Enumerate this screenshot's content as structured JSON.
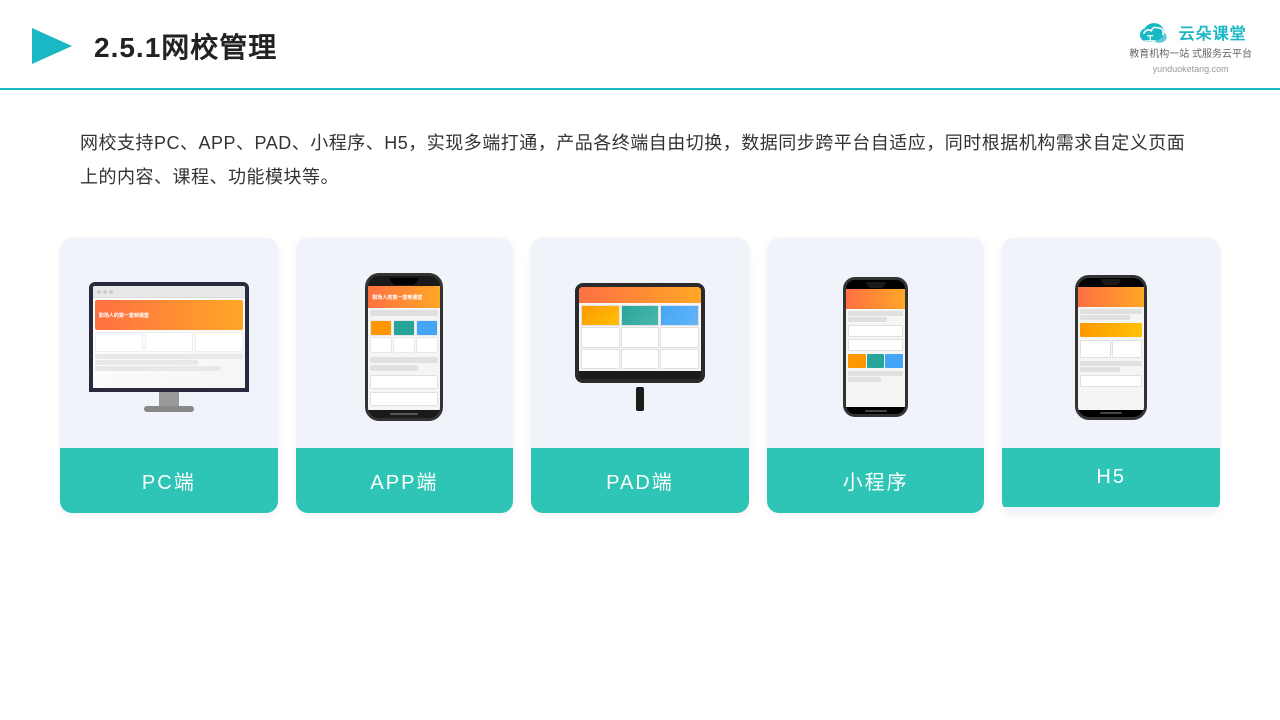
{
  "header": {
    "title": "2.5.1网校管理",
    "logo_name": "云朵课堂",
    "logo_url": "yunduoketang.com",
    "logo_tagline": "教育机构一站\n式服务云平台"
  },
  "description": {
    "text": "网校支持PC、APP、PAD、小程序、H5，实现多端打通，产品各终端自由切换，数据同步跨平台自适应，同时根据机构需求自定义页面上的内容、课程、功能模块等。"
  },
  "cards": [
    {
      "id": "pc",
      "label": "PC端",
      "type": "monitor"
    },
    {
      "id": "app",
      "label": "APP端",
      "type": "phone"
    },
    {
      "id": "pad",
      "label": "PAD端",
      "type": "tablet"
    },
    {
      "id": "miniprogram",
      "label": "小程序",
      "type": "phone-mini"
    },
    {
      "id": "h5",
      "label": "H5",
      "type": "phone-h5"
    }
  ],
  "colors": {
    "accent": "#2ec4b6",
    "header_border": "#1ab8c4",
    "logo": "#1ab8c4",
    "card_bg": "#eef2f8",
    "title": "#222222"
  }
}
